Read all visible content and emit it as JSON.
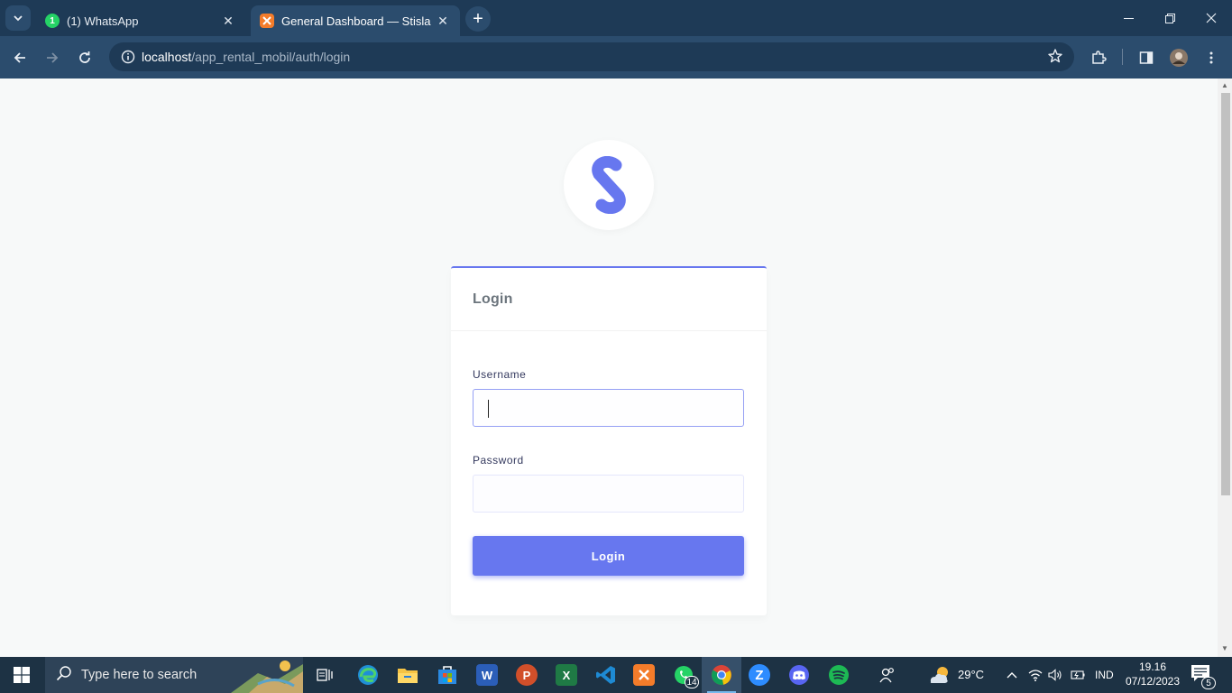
{
  "browser": {
    "tabs": [
      {
        "title": "(1) WhatsApp",
        "favicon_badge": "1",
        "active": false
      },
      {
        "title": "General Dashboard — Stisla",
        "active": true
      }
    ],
    "url_host": "localhost",
    "url_path": "/app_rental_mobil/auth/login",
    "colors": {
      "chrome_dark": "#1e3a56",
      "chrome_light": "#2b4c6d"
    }
  },
  "page": {
    "card_title": "Login",
    "username_label": "Username",
    "username_value": "",
    "password_label": "Password",
    "password_value": "",
    "login_button": "Login",
    "logo_letter": "S",
    "colors": {
      "primary": "#6777ef",
      "background": "#f7f9f9"
    }
  },
  "taskbar": {
    "search_placeholder": "Type here to search",
    "whatsapp_badge": "14",
    "weather": "29°C",
    "language": "IND",
    "time": "19.16",
    "date": "07/12/2023",
    "notifications": "5"
  }
}
